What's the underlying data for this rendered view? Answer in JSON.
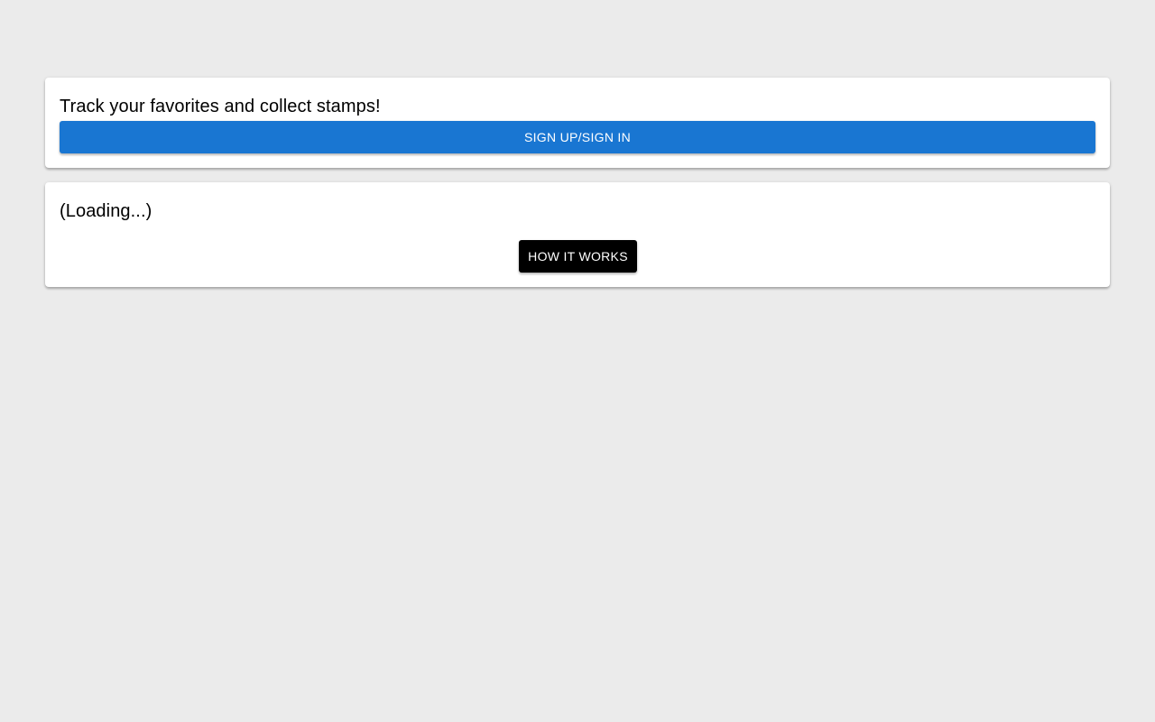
{
  "signin_card": {
    "title": "Track your favorites and collect stamps!",
    "button_label": "SIGN UP/SIGN IN"
  },
  "status_card": {
    "title": "(Loading...)",
    "button_label": "HOW IT WORKS"
  },
  "colors": {
    "background": "#ebebeb",
    "primary": "#1976d2",
    "secondary_button": "#000000"
  }
}
